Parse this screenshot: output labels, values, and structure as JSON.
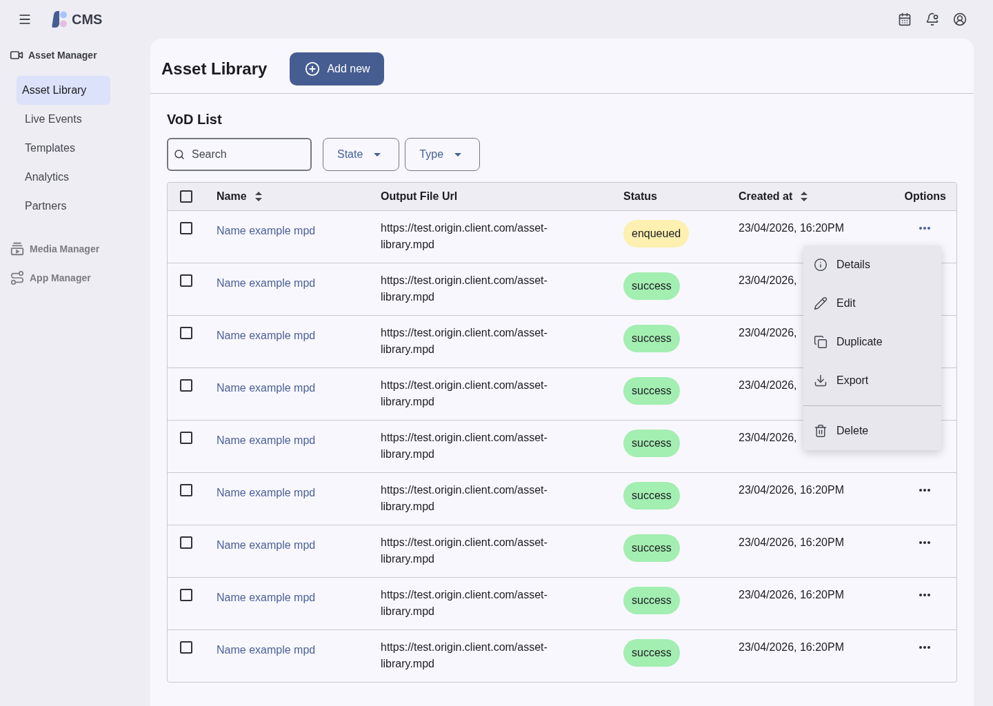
{
  "top_bar": {
    "app_name": "CMS"
  },
  "sidebar": {
    "sections": [
      {
        "title": "Asset Manager",
        "active": true,
        "items": [
          {
            "label": "Asset Library",
            "selected": true
          },
          {
            "label": "Live Events",
            "selected": false
          },
          {
            "label": "Templates",
            "selected": false
          },
          {
            "label": "Analytics",
            "selected": false
          },
          {
            "label": "Partners",
            "selected": false
          }
        ]
      },
      {
        "title": "Media Manager",
        "active": false
      },
      {
        "title": "App Manager",
        "active": false
      }
    ]
  },
  "page": {
    "title": "Asset Library",
    "add_button": "Add new"
  },
  "vod_list": {
    "title": "VoD List",
    "search": {
      "placeholder": "Search"
    },
    "filters": [
      "State",
      "Type"
    ]
  },
  "table": {
    "select_all": {
      "checked": false
    },
    "columns": [
      {
        "label": "Name",
        "sortable": true
      },
      {
        "label": "Output File Url",
        "sortable": false
      },
      {
        "label": "Status",
        "sortable": false
      },
      {
        "label": "Created at",
        "sortable": true
      },
      {
        "label": "Options",
        "sortable": false
      }
    ],
    "rows": [
      {
        "checked": false,
        "name": "Name example mpd",
        "url": "https://test.origin.client.com/asset-library.mpd",
        "status": {
          "label": "enqueued",
          "color": "#fdf0b0"
        },
        "created_at": "23/04/2026, 16:20PM",
        "options": {
          "active": true
        }
      },
      {
        "checked": false,
        "name": "Name example mpd",
        "url": "https://test.origin.client.com/asset-library.mpd",
        "status": {
          "label": "success",
          "color": "#a3eeb1"
        },
        "created_at": "23/04/2026,"
      },
      {
        "checked": false,
        "name": "Name example mpd",
        "url": "https://test.origin.client.com/asset-library.mpd",
        "status": {
          "label": "success",
          "color": "#a3eeb1"
        },
        "created_at": "23/04/2026,"
      },
      {
        "checked": false,
        "name": "Name example mpd",
        "url": "https://test.origin.client.com/asset-library.mpd",
        "status": {
          "label": "success",
          "color": "#a3eeb1"
        },
        "created_at": "23/04/2026,"
      },
      {
        "checked": false,
        "name": "Name example mpd",
        "url": "https://test.origin.client.com/asset-library.mpd",
        "status": {
          "label": "success",
          "color": "#a3eeb1"
        },
        "created_at": "23/04/2026,"
      },
      {
        "checked": false,
        "name": "Name example mpd",
        "url": "https://test.origin.client.com/asset-library.mpd",
        "status": {
          "label": "success",
          "color": "#a3eeb1"
        },
        "created_at": "23/04/2026, 16:20PM",
        "options": {
          "active": false
        }
      },
      {
        "checked": false,
        "name": "Name example mpd",
        "url": "https://test.origin.client.com/asset-library.mpd",
        "status": {
          "label": "success",
          "color": "#a3eeb1"
        },
        "created_at": "23/04/2026, 16:20PM",
        "options": {
          "active": false
        }
      },
      {
        "checked": false,
        "name": "Name example mpd",
        "url": "https://test.origin.client.com/asset-library.mpd",
        "status": {
          "label": "success",
          "color": "#a3eeb1"
        },
        "created_at": "23/04/2026, 16:20PM",
        "options": {
          "active": false
        }
      },
      {
        "checked": false,
        "name": "Name example mpd",
        "url": "https://test.origin.client.com/asset-library.mpd",
        "status": {
          "label": "success",
          "color": "#a3eeb1"
        },
        "created_at": "23/04/2026, 16:20PM",
        "options": {
          "active": false
        }
      }
    ]
  },
  "context_menu": {
    "groups": [
      [
        {
          "label": "Details"
        },
        {
          "label": "Edit"
        },
        {
          "label": "Duplicate"
        },
        {
          "label": "Export"
        }
      ],
      [
        {
          "label": "Delete"
        }
      ]
    ]
  }
}
